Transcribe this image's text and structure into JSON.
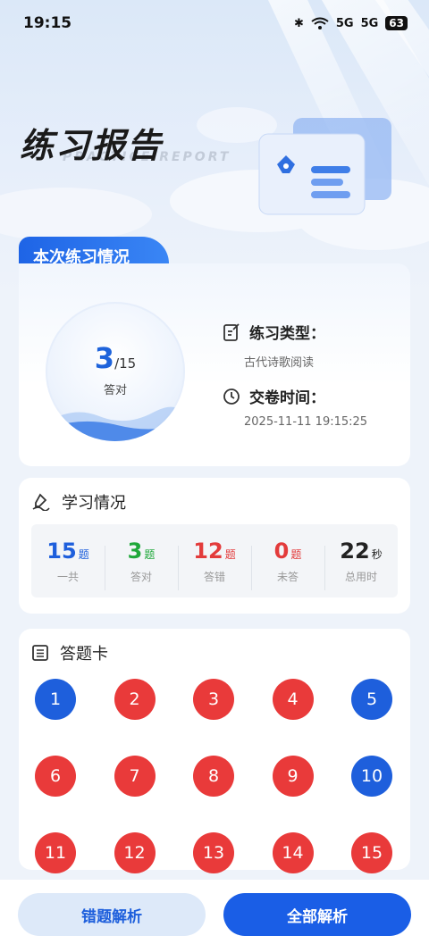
{
  "status": {
    "time": "19:15",
    "net1": "5G",
    "net2": "5G",
    "battery": "63"
  },
  "hero": {
    "title": "练习报告",
    "subtitle": "PRACTICE REPORT"
  },
  "summary": {
    "tab_label": "本次练习情况",
    "correct": "3",
    "total": "/15",
    "correct_label": "答对",
    "type_label": "练习类型：",
    "type_value": "古代诗歌阅读",
    "time_label": "交卷时间：",
    "time_value": "2025-11-11 19:15:25"
  },
  "study": {
    "title": "学习情况",
    "stats": [
      {
        "num": "15",
        "unit": "题",
        "label": "一共",
        "color": "#1e5fdc"
      },
      {
        "num": "3",
        "unit": "题",
        "label": "答对",
        "color": "#1fa83a"
      },
      {
        "num": "12",
        "unit": "题",
        "label": "答错",
        "color": "#e33b3b"
      },
      {
        "num": "0",
        "unit": "题",
        "label": "未答",
        "color": "#e33b3b"
      },
      {
        "num": "22",
        "unit": "秒",
        "label": "总用时",
        "color": "#222222"
      }
    ]
  },
  "answer_card": {
    "title": "答题卡",
    "questions": [
      {
        "n": "1",
        "correct": true
      },
      {
        "n": "2",
        "correct": false
      },
      {
        "n": "3",
        "correct": false
      },
      {
        "n": "4",
        "correct": false
      },
      {
        "n": "5",
        "correct": true
      },
      {
        "n": "6",
        "correct": false
      },
      {
        "n": "7",
        "correct": false
      },
      {
        "n": "8",
        "correct": false
      },
      {
        "n": "9",
        "correct": false
      },
      {
        "n": "10",
        "correct": true
      },
      {
        "n": "11",
        "correct": false
      },
      {
        "n": "12",
        "correct": false
      },
      {
        "n": "13",
        "correct": false
      },
      {
        "n": "14",
        "correct": false
      },
      {
        "n": "15",
        "correct": false
      }
    ]
  },
  "buttons": {
    "wrong_analysis": "错题解析",
    "all_analysis": "全部解析"
  },
  "colors": {
    "accent": "#1e5fdc",
    "correct": "#1e5fdc",
    "wrong": "#e93a3a"
  }
}
